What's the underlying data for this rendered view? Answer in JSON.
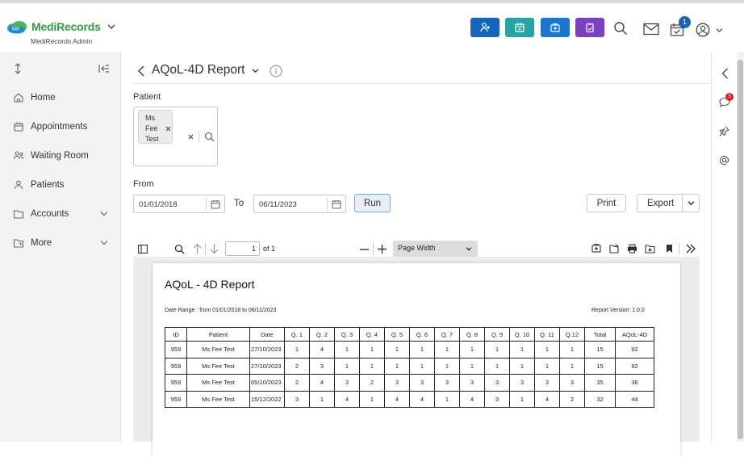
{
  "topbar": {
    "brand_name": "MediRecords",
    "brand_sub": "MediRecords Admin",
    "quick_buttons": [
      {
        "icon": "add-patient-icon",
        "color": "#1565c0"
      },
      {
        "icon": "calendar-add-icon",
        "color": "#26a3a5"
      },
      {
        "icon": "medical-bag-icon",
        "color": "#1976d2"
      },
      {
        "icon": "clipboard-icon",
        "color": "#7b3fc4"
      }
    ],
    "calendar_badge": "1"
  },
  "sidebar": {
    "items": [
      {
        "label": "Home",
        "icon": "home-icon"
      },
      {
        "label": "Appointments",
        "icon": "calendar-icon"
      },
      {
        "label": "Waiting Room",
        "icon": "waiting-room-icon"
      },
      {
        "label": "Patients",
        "icon": "patients-icon"
      },
      {
        "label": "Accounts",
        "icon": "folder-icon"
      },
      {
        "label": "More",
        "icon": "more-icon"
      }
    ]
  },
  "report": {
    "title": "AQoL-4D Report",
    "patient_label": "Patient",
    "patient_chip": [
      "Ms",
      "Fee",
      "Test"
    ],
    "from_label": "From",
    "from_value": "01/01/2018",
    "to_label": "To",
    "to_value": "06/11/2023",
    "run_label": "Run",
    "print_label": "Print",
    "export_label": "Export"
  },
  "viewer": {
    "page_number": "1",
    "page_of": "of 1",
    "zoom": "Page Width"
  },
  "document": {
    "title": "AQoL - 4D Report",
    "date_range": "Date Range : from 01/01/2018 to 06/11/2023",
    "version": "Report Version: 1.0.0",
    "columns": [
      "ID",
      "Patient",
      "Date",
      "Q. 1",
      "Q. 2",
      "Q. 3",
      "Q. 4",
      "Q. 5",
      "Q. 6",
      "Q. 7",
      "Q. 8",
      "Q. 9",
      "Q. 10",
      "Q. 11",
      "Q.12",
      "Total",
      "AQoL-4D"
    ],
    "rows": [
      [
        "959",
        "Ms Fee Test",
        "27/10/2023",
        "1",
        "4",
        "1",
        "1",
        "1",
        "1",
        "1",
        "1",
        "1",
        "1",
        "1",
        "1",
        "15",
        "92"
      ],
      [
        "959",
        "Ms Fee Test",
        "27/10/2023",
        "2",
        "3",
        "1",
        "1",
        "1",
        "1",
        "1",
        "1",
        "1",
        "1",
        "1",
        "1",
        "15",
        "92"
      ],
      [
        "959",
        "Ms Fee Test",
        "05/10/2023",
        "2",
        "4",
        "3",
        "2",
        "3",
        "3",
        "3",
        "3",
        "3",
        "3",
        "3",
        "3",
        "35",
        "36"
      ],
      [
        "959",
        "Ms Fee Test",
        "15/12/2022",
        "3",
        "1",
        "4",
        "1",
        "4",
        "4",
        "1",
        "4",
        "3",
        "1",
        "4",
        "2",
        "32",
        "44"
      ]
    ]
  },
  "rightbar": {
    "comments_badge": "3"
  }
}
